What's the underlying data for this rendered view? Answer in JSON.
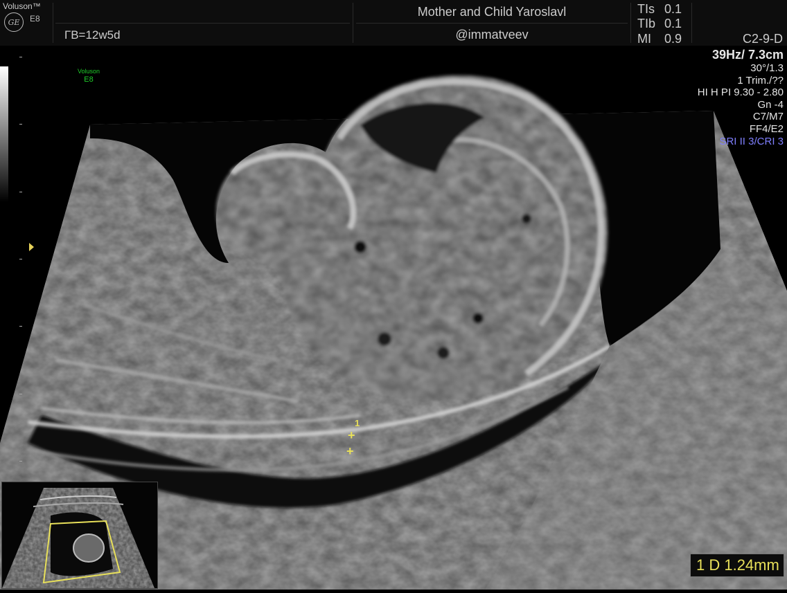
{
  "header": {
    "brand": "Voluson™",
    "logo": "GE",
    "model": "E8",
    "gestational_age": "ГВ=12w5d",
    "institution": "Mother and Child Yaroslavl",
    "handle": "@immatveev",
    "params": [
      {
        "label": "TIs",
        "value": "0.1"
      },
      {
        "label": "TIb",
        "value": "0.1"
      },
      {
        "label": "MI",
        "value": "0.9"
      }
    ],
    "probe": "C2-9-D"
  },
  "settings": {
    "frequency_depth": "39Hz/ 7.3cm",
    "angle": "30°/1.3",
    "preset": "1 Trim./??",
    "harmonics": "HI H PI 9.30 - 2.80",
    "gain": "Gn  -4",
    "compound": "C7/M7",
    "filter": "FF4/E2",
    "sri": "SRI II 3/CRI 3",
    "sri_color": "#7f7fff"
  },
  "watermark": {
    "brand": "Voluson",
    "model": "E8",
    "color": "#1fcf2a"
  },
  "caliper": {
    "index": "1",
    "symbol": "+",
    "color": "#e8e05a"
  },
  "measurement": {
    "text": "1 D 1.24mm"
  }
}
